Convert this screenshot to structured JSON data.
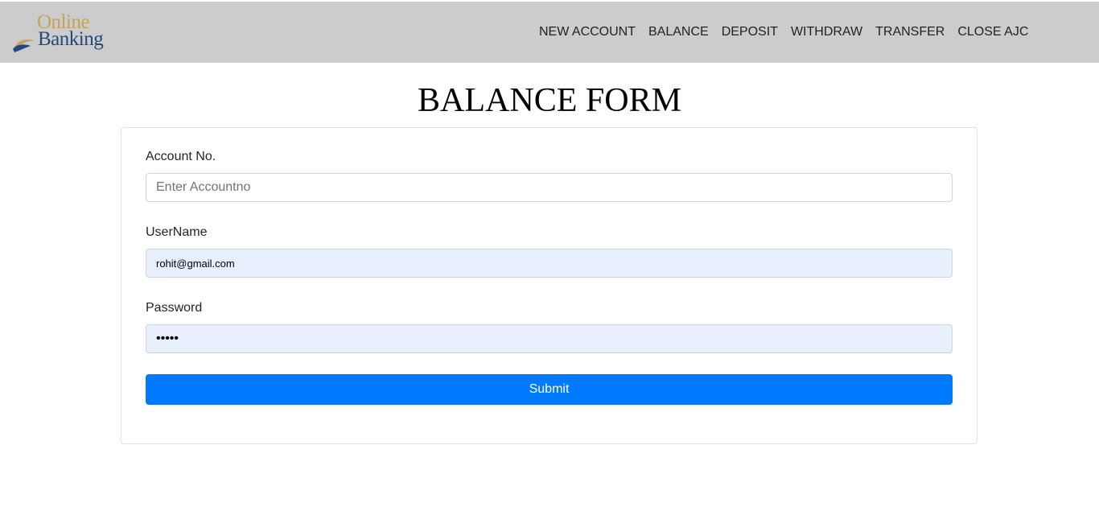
{
  "header": {
    "logo": {
      "line1": "Online",
      "line2": "Banking"
    },
    "nav": [
      {
        "label": "NEW ACCOUNT"
      },
      {
        "label": "BALANCE"
      },
      {
        "label": "DEPOSIT"
      },
      {
        "label": "WITHDRAW"
      },
      {
        "label": "TRANSFER"
      },
      {
        "label": "CLOSE AJC"
      }
    ]
  },
  "main": {
    "title": "BALANCE FORM",
    "form": {
      "account": {
        "label": "Account No.",
        "placeholder": "Enter Accountno",
        "value": ""
      },
      "username": {
        "label": "UserName",
        "value": "rohit@gmail.com"
      },
      "password": {
        "label": "Password",
        "value": "•••••"
      },
      "submit_label": "Submit"
    }
  },
  "colors": {
    "header_bg": "#cccccc",
    "primary_button": "#007bff",
    "autofill_bg": "#e8f0fe",
    "logo_gold": "#c5a35a",
    "logo_navy": "#24497d"
  }
}
